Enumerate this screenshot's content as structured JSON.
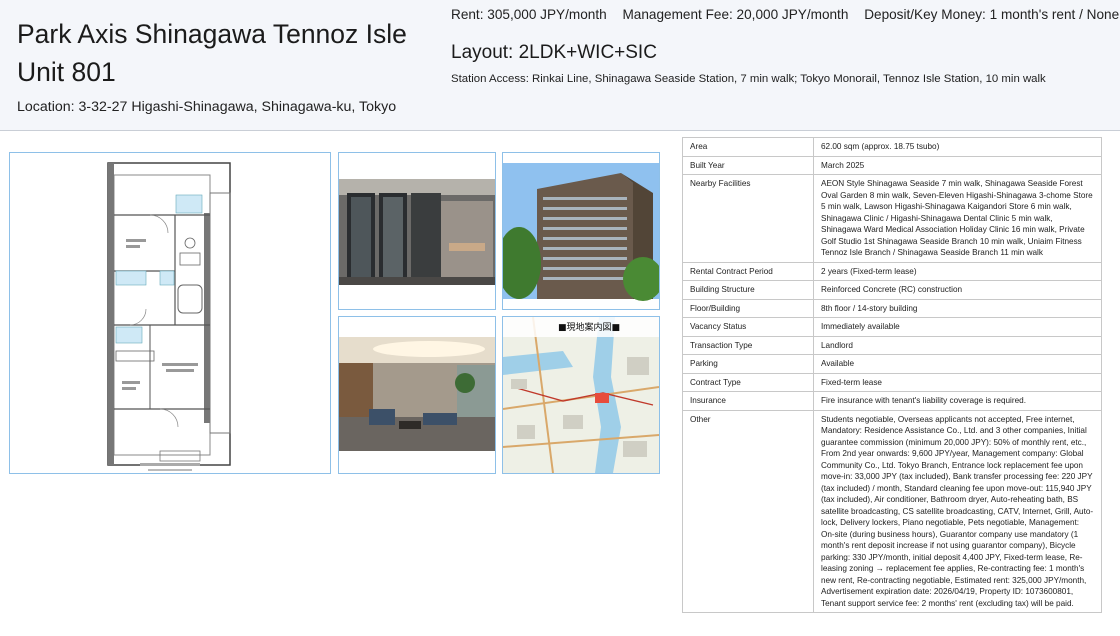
{
  "header": {
    "title": "Park Axis Shinagawa Tennoz Isle Unit 801",
    "location": "Location: 3-32-27 Higashi-Shinagawa, Shinagawa-ku, Tokyo",
    "rent": "Rent: 305,000 JPY/month",
    "management_fee": "Management Fee: 20,000 JPY/month",
    "deposit": "Deposit/Key Money: 1 month's rent / None",
    "layout": "Layout: 2LDK+WIC+SIC",
    "station_access": "Station Access: Rinkai Line, Shinagawa Seaside Station, 7 min walk; Tokyo Monorail, Tennoz Isle Station, 10 min walk"
  },
  "photos": {
    "map_label": "■現地案内図■"
  },
  "specs": [
    {
      "label": "Area",
      "value": "62.00 sqm (approx. 18.75 tsubo)"
    },
    {
      "label": "Built Year",
      "value": "March 2025"
    },
    {
      "label": "Nearby Facilities",
      "value": "AEON Style Shinagawa Seaside 7 min walk, Shinagawa Seaside Forest Oval Garden 8 min walk, Seven-Eleven Higashi-Shinagawa 3-chome Store 5 min walk, Lawson Higashi-Shinagawa Kaigandori Store 6 min walk, Shinagawa Clinic / Higashi-Shinagawa Dental Clinic 5 min walk, Shinagawa Ward Medical Association Holiday Clinic 16 min walk, Private Golf Studio 1st Shinagawa Seaside Branch 10 min walk, Uniaim Fitness Tennoz Isle Branch / Shinagawa Seaside Branch 11 min walk"
    },
    {
      "label": "Rental Contract Period",
      "value": "2 years (Fixed-term lease)"
    },
    {
      "label": "Building Structure",
      "value": "Reinforced Concrete (RC) construction"
    },
    {
      "label": "Floor/Building",
      "value": "8th floor / 14-story building"
    },
    {
      "label": "Vacancy Status",
      "value": "Immediately available"
    },
    {
      "label": "Transaction Type",
      "value": "Landlord"
    },
    {
      "label": "Parking",
      "value": "Available"
    },
    {
      "label": "Contract Type",
      "value": "Fixed-term lease"
    },
    {
      "label": "Insurance",
      "value": "Fire insurance with tenant's liability coverage is required."
    },
    {
      "label": "Other",
      "value": "Students negotiable, Overseas applicants not accepted, Free internet, Mandatory: Residence Assistance Co., Ltd. and 3 other companies, Initial guarantee commission (minimum 20,000 JPY): 50% of monthly rent, etc., From 2nd year onwards: 9,600 JPY/year, Management company: Global Community Co., Ltd. Tokyo Branch, Entrance lock replacement fee upon move-in: 33,000 JPY (tax included), Bank transfer processing fee: 220 JPY (tax included) / month, Standard cleaning fee upon move-out: 115,940 JPY (tax included), Air conditioner, Bathroom dryer, Auto-reheating bath, BS satellite broadcasting, CS satellite broadcasting, CATV, Internet, Grill, Auto-lock, Delivery lockers, Piano negotiable, Pets negotiable, Management: On-site (during business hours), Guarantor company use mandatory (1 month's rent deposit increase if not using guarantor company), Bicycle parking: 330 JPY/month, initial deposit 4,400 JPY, Fixed-term lease, Re-leasing zoning → replacement fee applies, Re-contracting fee: 1 month's new rent, Re-contracting negotiable, Estimated rent: 325,000 JPY/month, Advertisement expiration date: 2026/04/19, Property ID: 1073600801, Tenant support service fee: 2 months' rent (excluding tax) will be paid."
    }
  ],
  "colors": {
    "header_bg": "#f4f6fa",
    "photo_border": "#8ec0e8",
    "table_border": "#c8c8c8"
  }
}
